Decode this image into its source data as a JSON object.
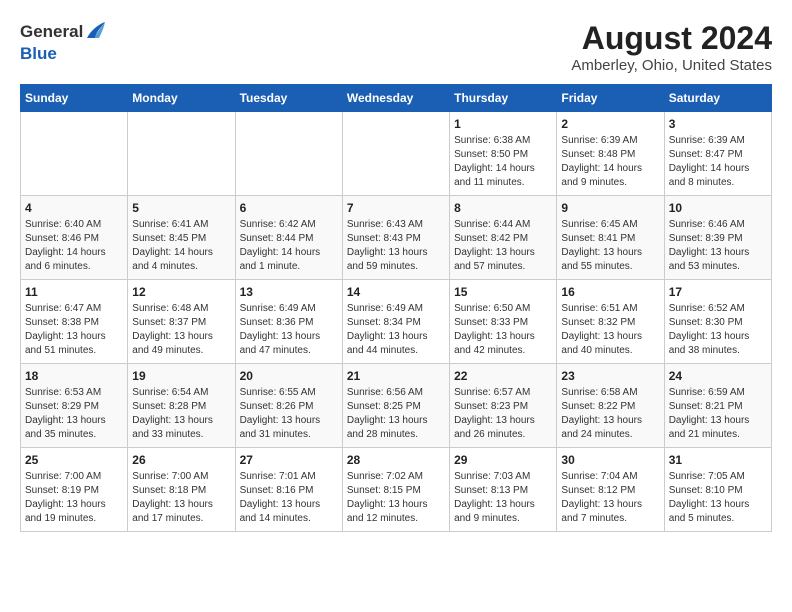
{
  "header": {
    "logo_general": "General",
    "logo_blue": "Blue",
    "month_year": "August 2024",
    "location": "Amberley, Ohio, United States"
  },
  "weekdays": [
    "Sunday",
    "Monday",
    "Tuesday",
    "Wednesday",
    "Thursday",
    "Friday",
    "Saturday"
  ],
  "weeks": [
    [
      {
        "day": "",
        "content": ""
      },
      {
        "day": "",
        "content": ""
      },
      {
        "day": "",
        "content": ""
      },
      {
        "day": "",
        "content": ""
      },
      {
        "day": "1",
        "content": "Sunrise: 6:38 AM\nSunset: 8:50 PM\nDaylight: 14 hours\nand 11 minutes."
      },
      {
        "day": "2",
        "content": "Sunrise: 6:39 AM\nSunset: 8:48 PM\nDaylight: 14 hours\nand 9 minutes."
      },
      {
        "day": "3",
        "content": "Sunrise: 6:39 AM\nSunset: 8:47 PM\nDaylight: 14 hours\nand 8 minutes."
      }
    ],
    [
      {
        "day": "4",
        "content": "Sunrise: 6:40 AM\nSunset: 8:46 PM\nDaylight: 14 hours\nand 6 minutes."
      },
      {
        "day": "5",
        "content": "Sunrise: 6:41 AM\nSunset: 8:45 PM\nDaylight: 14 hours\nand 4 minutes."
      },
      {
        "day": "6",
        "content": "Sunrise: 6:42 AM\nSunset: 8:44 PM\nDaylight: 14 hours\nand 1 minute."
      },
      {
        "day": "7",
        "content": "Sunrise: 6:43 AM\nSunset: 8:43 PM\nDaylight: 13 hours\nand 59 minutes."
      },
      {
        "day": "8",
        "content": "Sunrise: 6:44 AM\nSunset: 8:42 PM\nDaylight: 13 hours\nand 57 minutes."
      },
      {
        "day": "9",
        "content": "Sunrise: 6:45 AM\nSunset: 8:41 PM\nDaylight: 13 hours\nand 55 minutes."
      },
      {
        "day": "10",
        "content": "Sunrise: 6:46 AM\nSunset: 8:39 PM\nDaylight: 13 hours\nand 53 minutes."
      }
    ],
    [
      {
        "day": "11",
        "content": "Sunrise: 6:47 AM\nSunset: 8:38 PM\nDaylight: 13 hours\nand 51 minutes."
      },
      {
        "day": "12",
        "content": "Sunrise: 6:48 AM\nSunset: 8:37 PM\nDaylight: 13 hours\nand 49 minutes."
      },
      {
        "day": "13",
        "content": "Sunrise: 6:49 AM\nSunset: 8:36 PM\nDaylight: 13 hours\nand 47 minutes."
      },
      {
        "day": "14",
        "content": "Sunrise: 6:49 AM\nSunset: 8:34 PM\nDaylight: 13 hours\nand 44 minutes."
      },
      {
        "day": "15",
        "content": "Sunrise: 6:50 AM\nSunset: 8:33 PM\nDaylight: 13 hours\nand 42 minutes."
      },
      {
        "day": "16",
        "content": "Sunrise: 6:51 AM\nSunset: 8:32 PM\nDaylight: 13 hours\nand 40 minutes."
      },
      {
        "day": "17",
        "content": "Sunrise: 6:52 AM\nSunset: 8:30 PM\nDaylight: 13 hours\nand 38 minutes."
      }
    ],
    [
      {
        "day": "18",
        "content": "Sunrise: 6:53 AM\nSunset: 8:29 PM\nDaylight: 13 hours\nand 35 minutes."
      },
      {
        "day": "19",
        "content": "Sunrise: 6:54 AM\nSunset: 8:28 PM\nDaylight: 13 hours\nand 33 minutes."
      },
      {
        "day": "20",
        "content": "Sunrise: 6:55 AM\nSunset: 8:26 PM\nDaylight: 13 hours\nand 31 minutes."
      },
      {
        "day": "21",
        "content": "Sunrise: 6:56 AM\nSunset: 8:25 PM\nDaylight: 13 hours\nand 28 minutes."
      },
      {
        "day": "22",
        "content": "Sunrise: 6:57 AM\nSunset: 8:23 PM\nDaylight: 13 hours\nand 26 minutes."
      },
      {
        "day": "23",
        "content": "Sunrise: 6:58 AM\nSunset: 8:22 PM\nDaylight: 13 hours\nand 24 minutes."
      },
      {
        "day": "24",
        "content": "Sunrise: 6:59 AM\nSunset: 8:21 PM\nDaylight: 13 hours\nand 21 minutes."
      }
    ],
    [
      {
        "day": "25",
        "content": "Sunrise: 7:00 AM\nSunset: 8:19 PM\nDaylight: 13 hours\nand 19 minutes."
      },
      {
        "day": "26",
        "content": "Sunrise: 7:00 AM\nSunset: 8:18 PM\nDaylight: 13 hours\nand 17 minutes."
      },
      {
        "day": "27",
        "content": "Sunrise: 7:01 AM\nSunset: 8:16 PM\nDaylight: 13 hours\nand 14 minutes."
      },
      {
        "day": "28",
        "content": "Sunrise: 7:02 AM\nSunset: 8:15 PM\nDaylight: 13 hours\nand 12 minutes."
      },
      {
        "day": "29",
        "content": "Sunrise: 7:03 AM\nSunset: 8:13 PM\nDaylight: 13 hours\nand 9 minutes."
      },
      {
        "day": "30",
        "content": "Sunrise: 7:04 AM\nSunset: 8:12 PM\nDaylight: 13 hours\nand 7 minutes."
      },
      {
        "day": "31",
        "content": "Sunrise: 7:05 AM\nSunset: 8:10 PM\nDaylight: 13 hours\nand 5 minutes."
      }
    ]
  ]
}
